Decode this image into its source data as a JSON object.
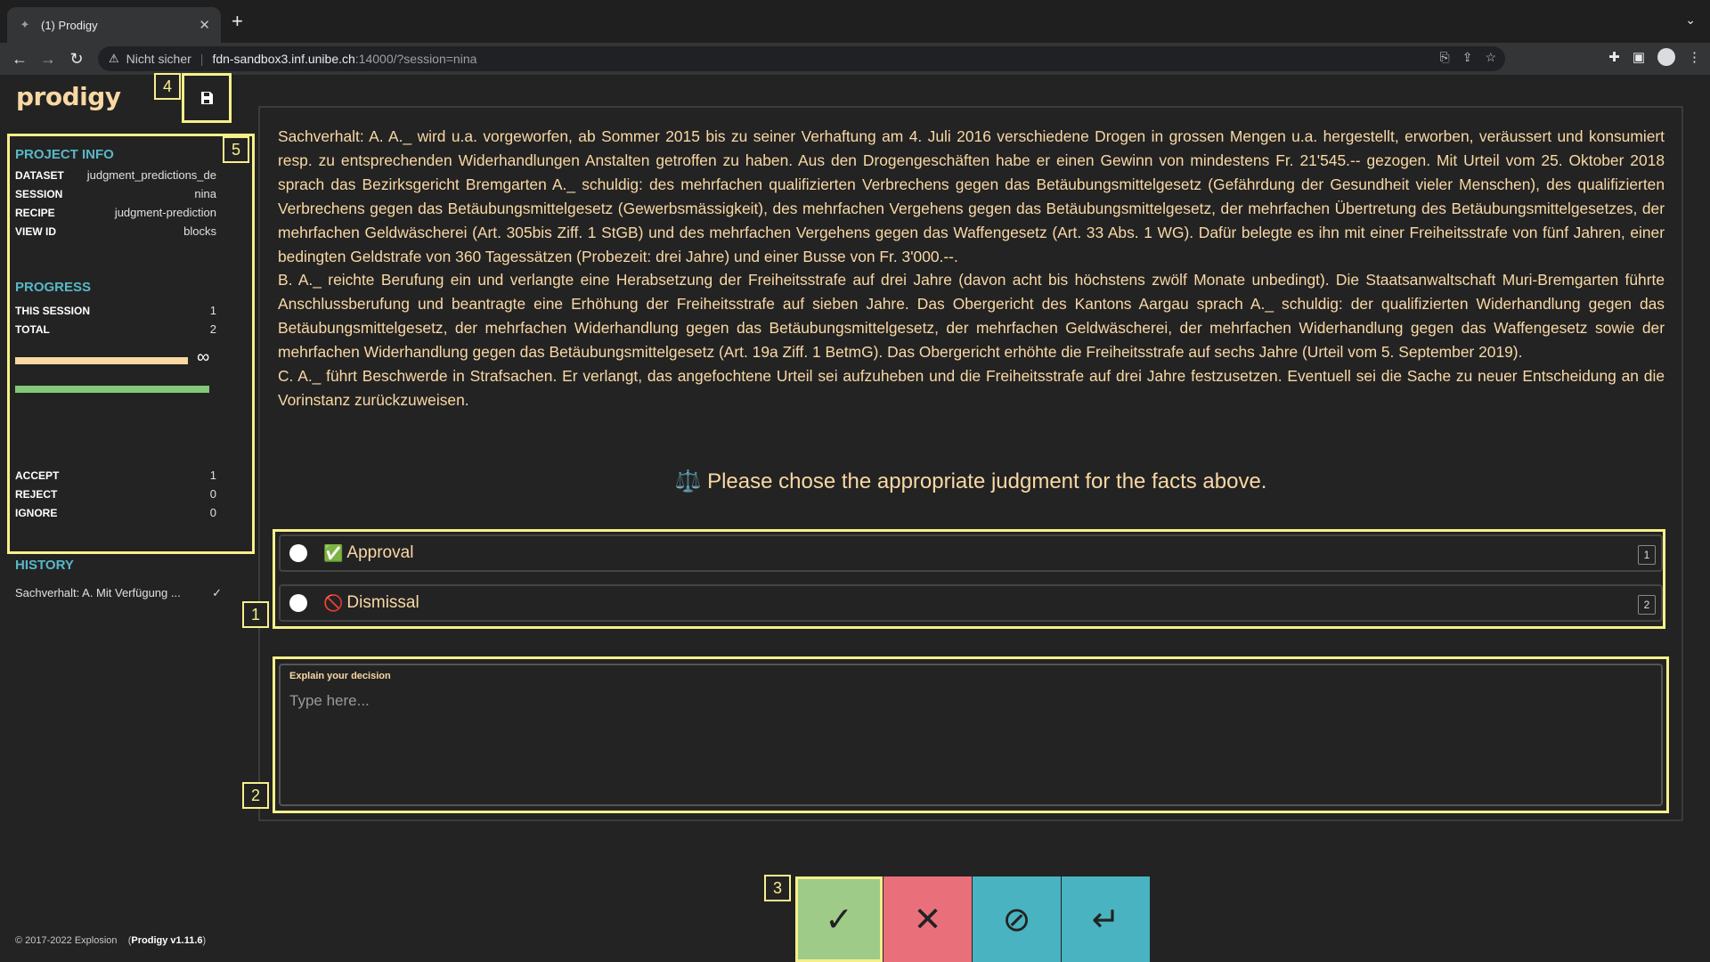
{
  "browser": {
    "tab_title": "(1) Prodigy",
    "new_tab": "+",
    "insecure_label": "Nicht sicher",
    "url_host": "fdn-sandbox3.inf.unibe.ch",
    "url_path": ":14000/?session=nina"
  },
  "app": {
    "logo": "prodigy",
    "footer_copyright": "© 2017-2022 Explosion",
    "footer_version": "Prodigy v1.11.6"
  },
  "sidebar": {
    "project_info": {
      "heading": "PROJECT INFO",
      "rows": [
        {
          "key": "DATASET",
          "value": "judgment_predictions_de"
        },
        {
          "key": "SESSION",
          "value": "nina"
        },
        {
          "key": "RECIPE",
          "value": "judgment-prediction"
        },
        {
          "key": "VIEW ID",
          "value": "blocks"
        }
      ]
    },
    "progress": {
      "heading": "PROGRESS",
      "rows": [
        {
          "key": "THIS SESSION",
          "value": "1"
        },
        {
          "key": "TOTAL",
          "value": "2"
        }
      ],
      "counts": [
        {
          "key": "ACCEPT",
          "value": "1"
        },
        {
          "key": "REJECT",
          "value": "0"
        },
        {
          "key": "IGNORE",
          "value": "0"
        }
      ],
      "infinity": "∞"
    },
    "history": {
      "heading": "HISTORY",
      "item": "Sachverhalt: A. Mit Verfügung ...",
      "item_status": "✓"
    }
  },
  "main": {
    "facts": [
      "Sachverhalt: A. A._ wird u.a. vorgeworfen, ab Sommer 2015 bis zu seiner Verhaftung am 4. Juli 2016 verschiedene Drogen in grossen Mengen u.a. hergestellt, erworben, veräussert und konsumiert resp. zu entsprechenden Widerhandlungen Anstalten getroffen zu haben. Aus den Drogengeschäften habe er einen Gewinn von mindestens Fr. 21'545.-- gezogen. Mit Urteil vom 25. Oktober 2018 sprach das Bezirksgericht Bremgarten A._ schuldig: des mehrfachen qualifizierten Verbrechens gegen das Betäubungsmittelgesetz (Gefährdung der Gesundheit vieler Menschen), des qualifizierten Verbrechens gegen das Betäubungsmittelgesetz (Gewerbsmässigkeit), des mehrfachen Vergehens gegen das Betäubungsmittelgesetz, der mehrfachen Übertretung des Betäubungsmittelgesetzes, der mehrfachen Geldwäscherei (Art. 305bis Ziff. 1 StGB) und des mehrfachen Vergehens gegen das Waffengesetz (Art. 33 Abs. 1 WG). Dafür belegte es ihn mit einer Freiheitsstrafe von fünf Jahren, einer bedingten Geldstrafe von 360 Tagessätzen (Probezeit: drei Jahre) und einer Busse von Fr. 3'000.--.",
      "B. A._ reichte Berufung ein und verlangte eine Herabsetzung der Freiheitsstrafe auf drei Jahre (davon acht bis höchstens zwölf Monate unbedingt). Die Staatsanwaltschaft Muri-Bremgarten führte Anschlussberufung und beantragte eine Erhöhung der Freiheitsstrafe auf sieben Jahre. Das Obergericht des Kantons Aargau sprach A._ schuldig: der qualifizierten Widerhandlung gegen das Betäubungsmittelgesetz, der mehrfachen Widerhandlung gegen das Betäubungsmittelgesetz, der mehrfachen Geldwäscherei, der mehrfachen Widerhandlung gegen das Waffengesetz sowie der mehrfachen Widerhandlung gegen das Betäubungsmittelgesetz (Art. 19a Ziff. 1 BetmG). Das Obergericht erhöhte die Freiheitsstrafe auf sechs Jahre (Urteil vom 5. September 2019).",
      "C. A._ führt Beschwerde in Strafsachen. Er verlangt, das angefochtene Urteil sei aufzuheben und die Freiheitsstrafe auf drei Jahre festzusetzen. Eventuell sei die Sache zu neuer Entscheidung an die Vorinstanz zurückzuweisen."
    ],
    "question_icon": "⚖️",
    "question": "Please chose the appropriate judgment for the facts above.",
    "choices": [
      {
        "emoji": "✅",
        "label": "Approval",
        "key": "1"
      },
      {
        "emoji": "🚫",
        "label": "Dismissal",
        "key": "2"
      }
    ],
    "explain_label": "Explain your decision",
    "explain_placeholder": "Type here..."
  },
  "annotations": {
    "labels": [
      "1",
      "2",
      "3",
      "4",
      "5"
    ]
  },
  "actions": {
    "accept": "✓",
    "reject": "✕",
    "ignore": "⊘",
    "undo": "↵"
  },
  "colors": {
    "accent_text": "#f9d8a4",
    "sidebar_heading": "#58b8c7",
    "accept": "#9ecb87",
    "reject": "#e9707a",
    "ignore": "#4ab3c1",
    "highlight": "#f7f08a"
  }
}
